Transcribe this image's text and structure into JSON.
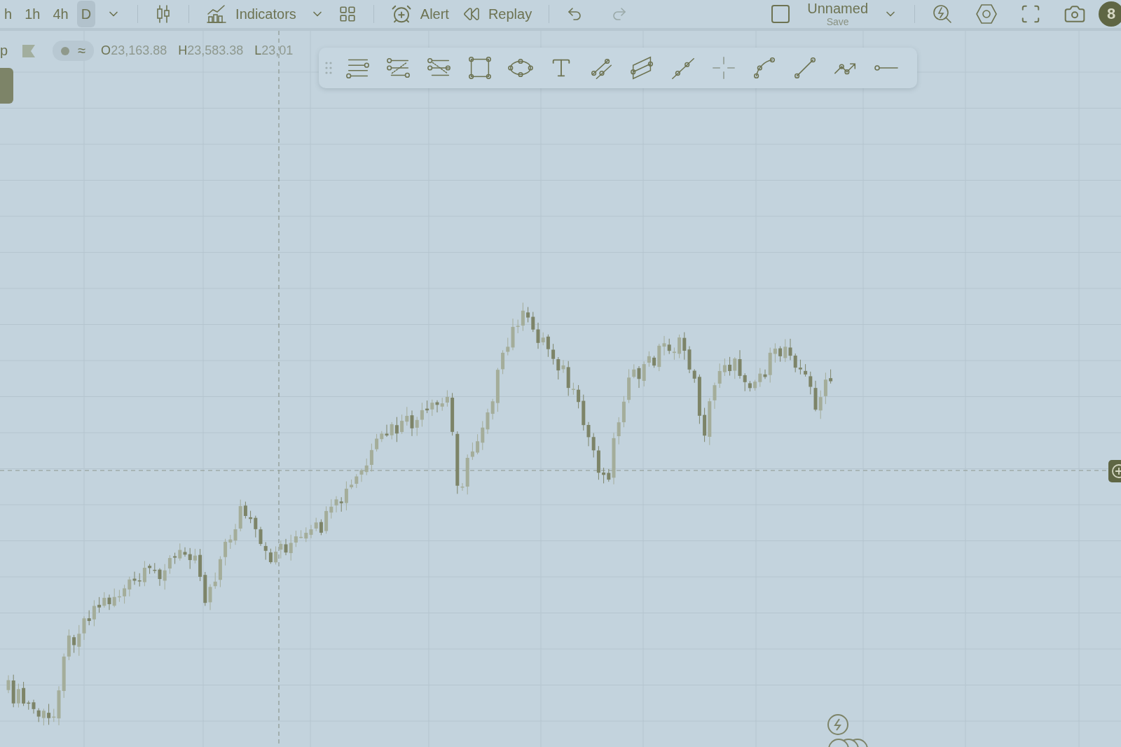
{
  "topbar": {
    "intervals": [
      {
        "label": "h",
        "selected": false
      },
      {
        "label": "1h",
        "selected": false
      },
      {
        "label": "4h",
        "selected": false
      },
      {
        "label": "D",
        "selected": true
      }
    ],
    "indicators": "Indicators",
    "alert": "Alert",
    "replay": "Replay",
    "undo": {
      "disabled": false
    },
    "redo": {
      "disabled": true
    },
    "layout": {
      "name": "Unnamed",
      "action": "Save"
    },
    "badge": "8"
  },
  "legend": {
    "symbol": "p",
    "toggle_glyph": "≈",
    "fields": [
      {
        "key": "O",
        "value": "23,163.88"
      },
      {
        "key": "H",
        "value": "23,583.38"
      },
      {
        "key": "L",
        "value": "23,01"
      }
    ]
  },
  "drawing_toolbar": {
    "tools": [
      {
        "kind": "horizontal-lines"
      },
      {
        "kind": "channel"
      },
      {
        "kind": "channel-reverse"
      },
      {
        "kind": "rectangle"
      },
      {
        "kind": "ellipse"
      },
      {
        "kind": "text"
      },
      {
        "kind": "parallel-lines"
      },
      {
        "kind": "parallelogram"
      },
      {
        "kind": "ray"
      },
      {
        "kind": "crosshair"
      },
      {
        "kind": "curve"
      },
      {
        "kind": "segment"
      },
      {
        "kind": "polyline"
      },
      {
        "kind": "horizontal-ray"
      }
    ]
  }
}
